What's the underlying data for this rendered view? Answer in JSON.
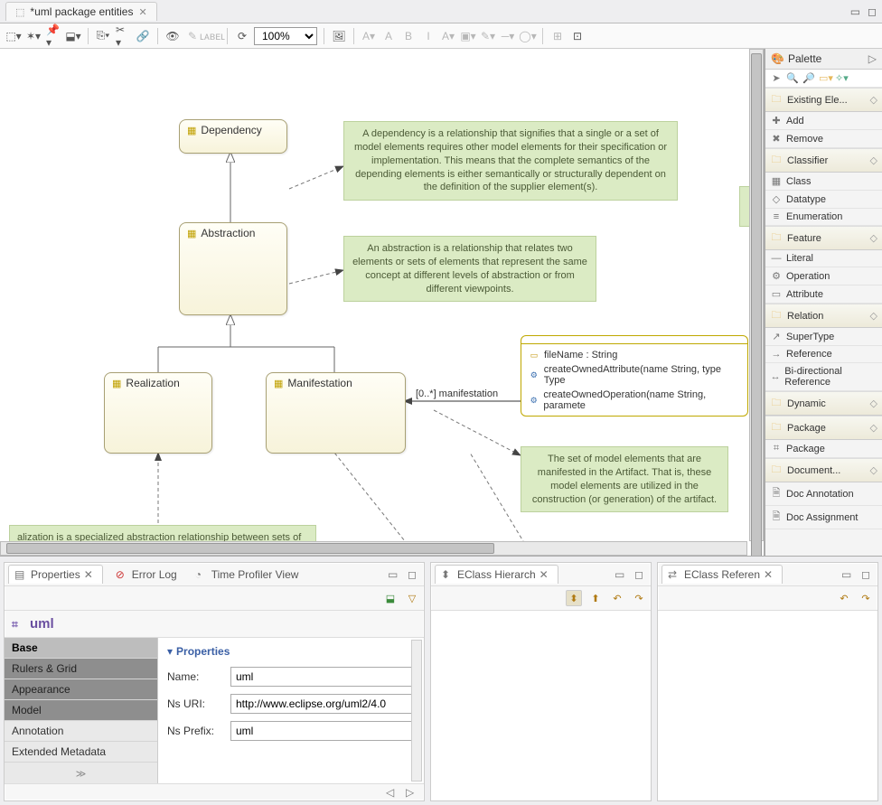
{
  "editor": {
    "tab_title": "*uml package entities",
    "zoom": "100%"
  },
  "diagram": {
    "classes": {
      "dependency": "Dependency",
      "abstraction": "Abstraction",
      "realization": "Realization",
      "manifestation": "Manifestation"
    },
    "edge_labels": {
      "manifestation": "[0..*] manifestation"
    },
    "component": {
      "attr1": "fileName : String",
      "op1": "createOwnedAttribute(name String, type Type",
      "op2": "createOwnedOperation(name String, paramete"
    },
    "notes": {
      "dependency": "A dependency is a relationship that signifies that a single or a set of model elements requires other model elements for their specification or implementation. This means that the complete semantics of the depending elements is either semantically or structurally dependent on the definition of the supplier element(s).",
      "abstraction": "An abstraction is a relationship that relates two elements or sets of elements that represent the same concept at different levels of abstraction or from different viewpoints.",
      "manifestation": "The set of model elements that are manifested in the Artifact. That is, these model elements are utilized in the construction (or generation) of the artifact.",
      "realization": "alization is a specialized abstraction relationship between sets of model elements, one representing a specification e supplier) and the other represents an implementation of the latter (the client). Realization can be used to model"
    }
  },
  "palette": {
    "title": "Palette",
    "groups": {
      "existing": {
        "label": "Existing Ele...",
        "items": [
          {
            "icon": "✚",
            "label": "Add"
          },
          {
            "icon": "✖",
            "label": "Remove"
          }
        ]
      },
      "classifier": {
        "label": "Classifier",
        "items": [
          {
            "icon": "▦",
            "label": "Class"
          },
          {
            "icon": "◇",
            "label": "Datatype"
          },
          {
            "icon": "≡",
            "label": "Enumeration"
          }
        ]
      },
      "feature": {
        "label": "Feature",
        "items": [
          {
            "icon": "—",
            "label": "Literal"
          },
          {
            "icon": "⚙",
            "label": "Operation"
          },
          {
            "icon": "▭",
            "label": "Attribute"
          }
        ]
      },
      "relation": {
        "label": "Relation",
        "items": [
          {
            "icon": "↗",
            "label": "SuperType"
          },
          {
            "icon": "→",
            "label": "Reference"
          },
          {
            "icon": "↔",
            "label": "Bi-directional Reference"
          }
        ]
      },
      "dynamic": {
        "label": "Dynamic",
        "items": []
      },
      "package": {
        "label": "Package",
        "items": [
          {
            "icon": "⌗",
            "label": "Package"
          }
        ]
      },
      "document": {
        "label": "Document...",
        "items": [
          {
            "icon": "🗎",
            "label": "Doc Annotation"
          },
          {
            "icon": "🗎",
            "label": "Doc Assignment"
          }
        ]
      }
    }
  },
  "views": {
    "properties_tab": "Properties",
    "errorlog_tab": "Error Log",
    "timeprofiler_tab": "Time Profiler View",
    "eclass_hierarch_tab": "EClass Hierarch",
    "eclass_referen_tab": "EClass Referen"
  },
  "properties": {
    "heading": "uml",
    "section_title": "Properties",
    "nav": {
      "base": "Base",
      "rulers": "Rulers & Grid",
      "appearance": "Appearance",
      "model": "Model",
      "annotation": "Annotation",
      "extmeta": "Extended Metadata"
    },
    "fields": {
      "name_label": "Name:",
      "name_value": "uml",
      "nsuri_label": "Ns URI:",
      "nsuri_value": "http://www.eclipse.org/uml2/4.0",
      "nsprefix_label": "Ns Prefix:",
      "nsprefix_value": "uml"
    }
  }
}
